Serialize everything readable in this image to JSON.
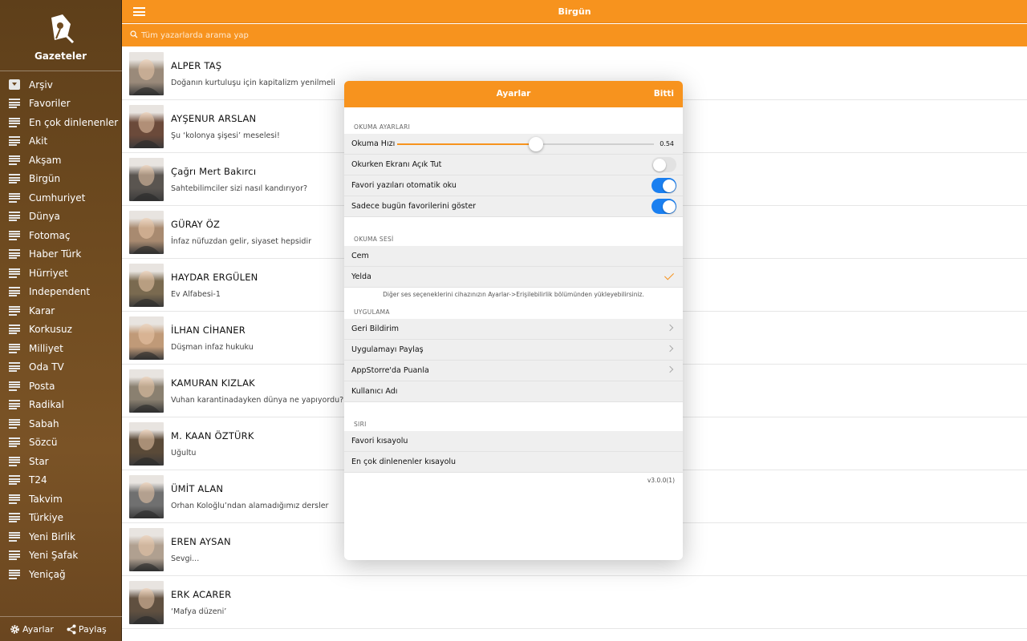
{
  "app": {
    "name": "Gazeteler",
    "title": "Birgün"
  },
  "search": {
    "placeholder": "Tüm yazarlarda arama yap"
  },
  "sidebar": {
    "items": [
      {
        "label": "Arşiv",
        "icon": "archive-icon"
      },
      {
        "label": "Favoriler",
        "icon": "list-icon"
      },
      {
        "label": "En çok dinlenenler",
        "icon": "list-icon"
      },
      {
        "label": "Akit",
        "icon": "list-icon"
      },
      {
        "label": "Akşam",
        "icon": "list-icon"
      },
      {
        "label": "Birgün",
        "icon": "list-icon"
      },
      {
        "label": "Cumhuriyet",
        "icon": "list-icon"
      },
      {
        "label": "Dünya",
        "icon": "list-icon"
      },
      {
        "label": "Fotomaç",
        "icon": "list-icon"
      },
      {
        "label": "Haber Türk",
        "icon": "list-icon"
      },
      {
        "label": "Hürriyet",
        "icon": "list-icon"
      },
      {
        "label": "Independent",
        "icon": "list-icon"
      },
      {
        "label": "Karar",
        "icon": "list-icon"
      },
      {
        "label": "Korkusuz",
        "icon": "list-icon"
      },
      {
        "label": "Milliyet",
        "icon": "list-icon"
      },
      {
        "label": "Oda TV",
        "icon": "list-icon"
      },
      {
        "label": "Posta",
        "icon": "list-icon"
      },
      {
        "label": "Radikal",
        "icon": "list-icon"
      },
      {
        "label": "Sabah",
        "icon": "list-icon"
      },
      {
        "label": "Sözcü",
        "icon": "list-icon"
      },
      {
        "label": "Star",
        "icon": "list-icon"
      },
      {
        "label": "T24",
        "icon": "list-icon"
      },
      {
        "label": "Takvim",
        "icon": "list-icon"
      },
      {
        "label": "Türkiye",
        "icon": "list-icon"
      },
      {
        "label": "Yeni Birlik",
        "icon": "list-icon"
      },
      {
        "label": "Yeni Şafak",
        "icon": "list-icon"
      },
      {
        "label": "Yeniçağ",
        "icon": "list-icon"
      }
    ],
    "footer": {
      "settings_label": "Ayarlar",
      "share_label": "Paylaş"
    }
  },
  "authors": [
    {
      "name": "ALPER TAŞ",
      "headline": "Doğanın kurtuluşu için kapitalizm yenilmeli",
      "tone": "#9a8a7a"
    },
    {
      "name": "AYŞENUR ARSLAN",
      "headline": "Şu ‘kolonya şişesi’ meselesi!",
      "tone": "#6b4a3a"
    },
    {
      "name": "Çağrı Mert Bakırcı",
      "headline": "Sahtebilimciler sizi nasıl kandırıyor?",
      "tone": "#5a5550"
    },
    {
      "name": "GÜRAY ÖZ",
      "headline": "İnfaz nüfuzdan gelir, siyaset hepsidir",
      "tone": "#a88a70"
    },
    {
      "name": "HAYDAR ERGÜLEN",
      "headline": "Ev Alfabesi-1",
      "tone": "#7a6a50"
    },
    {
      "name": "İLHAN CİHANER",
      "headline": "Düşman infaz hukuku",
      "tone": "#c09a78"
    },
    {
      "name": "KAMURAN KIZLAK",
      "headline": "Vuhan karantinadayken dünya ne yapıyordu?",
      "tone": "#8a8070"
    },
    {
      "name": "M. KAAN ÖZTÜRK",
      "headline": "Uğultu",
      "tone": "#5a4a38"
    },
    {
      "name": "ÜMİT ALAN",
      "headline": "Orhan Koloğlu’ndan alamadığımız dersler",
      "tone": "#707070"
    },
    {
      "name": "EREN AYSAN",
      "headline": "Sevgi...",
      "tone": "#b0a090"
    },
    {
      "name": "ERK ACARER",
      "headline": "‘Mafya düzeni’",
      "tone": "#605040"
    }
  ],
  "settings": {
    "title": "Ayarlar",
    "done_label": "Bitti",
    "reading": {
      "section": "OKUMA AYARLARI",
      "speed_label": "Okuma Hızı",
      "speed_value": 0.54,
      "speed_display": "0.54",
      "screen_on_label": "Okurken Ekranı Açık Tut",
      "screen_on": false,
      "auto_read_label": "Favori yazıları otomatik oku",
      "auto_read": true,
      "today_only_label": "Sadece bugün favorilerini göster",
      "today_only": true
    },
    "voice": {
      "section": "OKUMA SESİ",
      "options": [
        "Cem",
        "Yelda"
      ],
      "selected": "Yelda",
      "note": "Diğer ses seçeneklerini cihazınızın Ayarlar->Erişilebilirlik bölümünden yükleyebilirsiniz."
    },
    "app_section": {
      "section": "UYGULAMA",
      "feedback": "Geri Bildirim",
      "share_app": "Uygulamayı Paylaş",
      "rate": "AppStorre'da Puanla",
      "username": "Kullanıcı Adı"
    },
    "siri": {
      "section": "SIRI",
      "fav_shortcut": "Favori kısayolu",
      "top_shortcut": "En çok dinlenenler kısayolu"
    },
    "version": "v3.0.0(1)"
  },
  "colors": {
    "accent": "#f7931e",
    "toggle_on": "#1a7ff0",
    "sidebar": "#6f4b20"
  }
}
